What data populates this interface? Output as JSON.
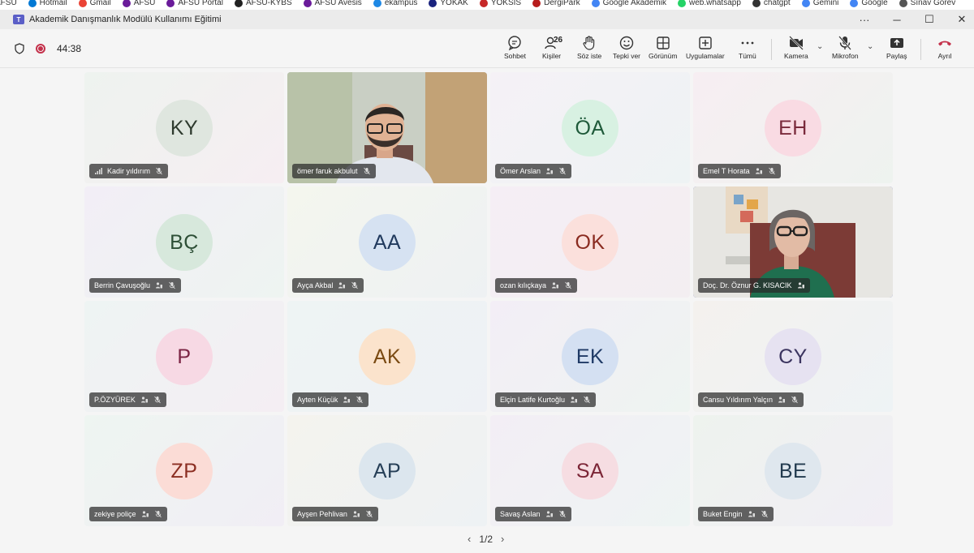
{
  "bookmarks": [
    "AFSÜ",
    "Hotmail",
    "Gmail",
    "AFSÜ",
    "AFSÜ Portal",
    "AFSÜ-KYBS",
    "AFSU Avesis",
    "ekampus",
    "YÖKAK",
    "YÖKSİS",
    "DergiPark",
    "Google Akademik",
    "web.whatsapp",
    "chatgpt",
    "Gemini",
    "Google",
    "Sınav Görev"
  ],
  "bookmark_colors": [
    "#1565c0",
    "#0078d4",
    "#ea4335",
    "#6a1b9a",
    "#6a1b9a",
    "#222222",
    "#6a1b9a",
    "#1e88e5",
    "#1a237e",
    "#c62828",
    "#b71c1c",
    "#4285f4",
    "#25d366",
    "#333333",
    "#4285f4",
    "#4285f4",
    "#555555"
  ],
  "window": {
    "title": "Akademik Danışmanlık Modülü Kullanımı Eğitimi",
    "more": "···",
    "minimize": "─",
    "maximize": "☐",
    "close": "✕"
  },
  "meeting": {
    "elapsed": "44:38",
    "people_count": "26"
  },
  "toolbar": {
    "chat": "Sohbet",
    "people": "Kişiler",
    "raise_hand": "Söz iste",
    "react": "Tepki ver",
    "view": "Görünüm",
    "apps": "Uygulamalar",
    "more": "Tümü",
    "camera": "Kamera",
    "mic": "Mikrofon",
    "share": "Paylaş",
    "leave": "Ayrıl"
  },
  "participants": [
    {
      "initials": "KY",
      "name": "Kadir yıldırım",
      "bg": "#dfe6df",
      "fg": "#2e3a2e",
      "tile": "linear-gradient(135deg,#eef3ef,#f6eef2)",
      "video": false,
      "signal": true
    },
    {
      "initials": "",
      "name": "ömer faruk akbulut",
      "video": true,
      "variant": "man"
    },
    {
      "initials": "ÖA",
      "name": "Ömer Arslan",
      "bg": "#d8f1e2",
      "fg": "#1f5a3a",
      "tile": "linear-gradient(135deg,#f5f1f6,#eef3f4)",
      "video": false
    },
    {
      "initials": "EH",
      "name": "Emel T Horata",
      "bg": "#f9dbe3",
      "fg": "#7a2a3c",
      "tile": "linear-gradient(135deg,#f7eef2,#eef3ef)",
      "video": false
    },
    {
      "initials": "BÇ",
      "name": "Berrin Çavuşoğlu",
      "bg": "#d7e8dc",
      "fg": "#2d4f36",
      "tile": "linear-gradient(135deg,#f2eef6,#eef4f1)",
      "video": false
    },
    {
      "initials": "AA",
      "name": "Ayça Akbal",
      "bg": "#d6e2f2",
      "fg": "#213a5e",
      "tile": "linear-gradient(135deg,#f4f6ee,#eef1f3)",
      "video": false
    },
    {
      "initials": "OK",
      "name": "ozan kılıçkaya",
      "bg": "#fbe0dc",
      "fg": "#8a2b20",
      "tile": "linear-gradient(135deg,#f5eef5,#f3eef1)",
      "video": false
    },
    {
      "initials": "",
      "name": "Doç. Dr. Öznur G. KISACIK",
      "video": true,
      "variant": "woman",
      "active": true
    },
    {
      "initials": "P",
      "name": "P.ÖZYÜREK",
      "bg": "#f7d9e4",
      "fg": "#7b2444",
      "tile": "linear-gradient(135deg,#eef4f3,#f4eef3)",
      "video": false
    },
    {
      "initials": "AK",
      "name": "Ayten Küçük",
      "bg": "#fbe3cc",
      "fg": "#7a4a12",
      "tile": "linear-gradient(135deg,#eef4f4,#eef1f5)",
      "video": false
    },
    {
      "initials": "EK",
      "name": "Elçin Latife Kurtoğlu",
      "bg": "#d4e0f2",
      "fg": "#1f3a66",
      "tile": "linear-gradient(135deg,#f3eef6,#eef4f1)",
      "video": false
    },
    {
      "initials": "CY",
      "name": "Cansu Yıldırım Yalçın",
      "bg": "#e6e2f1",
      "fg": "#3c3560",
      "tile": "linear-gradient(135deg,#f4f1ee,#eef3f5)",
      "video": false
    },
    {
      "initials": "ZP",
      "name": "zekiye poliçe",
      "bg": "#fbdcd6",
      "fg": "#8b2e22",
      "tile": "linear-gradient(135deg,#eef5f1,#f1eef5)",
      "video": false
    },
    {
      "initials": "AP",
      "name": "Ayşen Pehlivan",
      "bg": "#dce6ee",
      "fg": "#263f57",
      "tile": "linear-gradient(135deg,#f4f3ee,#eef2f4)",
      "video": false
    },
    {
      "initials": "SA",
      "name": "Savaş Aslan",
      "bg": "#f6dde2",
      "fg": "#7c2637",
      "tile": "linear-gradient(135deg,#f3eef5,#eef4f3)",
      "video": false
    },
    {
      "initials": "BE",
      "name": "Buket Engin",
      "bg": "#dfe7ee",
      "fg": "#233b4f",
      "tile": "linear-gradient(135deg,#eef3ee,#f1eef5)",
      "video": false
    }
  ],
  "pager": {
    "label": "1/2"
  }
}
